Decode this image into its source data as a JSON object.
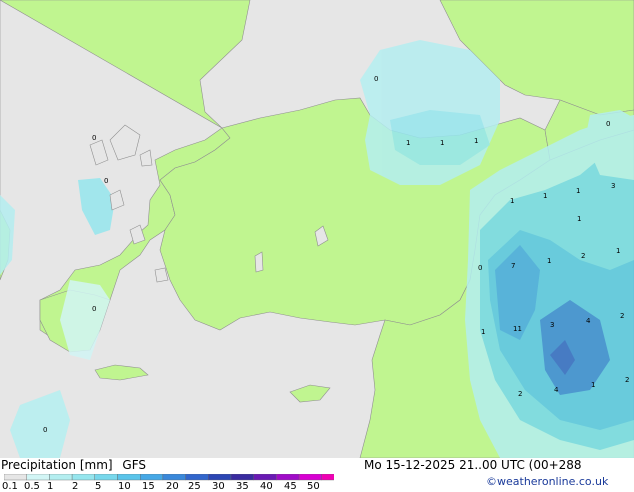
{
  "title": "Precipitation [mm]",
  "model": "GFS",
  "valid_time": "Mo 15-12-2025 21..00 UTC (00+288",
  "credit": "©weatheronline.co.uk",
  "colors": {
    "land": "#c0f590",
    "sea": "#e6e6e6",
    "border": "#909090"
  },
  "legend": {
    "labels": [
      "0.1",
      "0.5",
      "1",
      "2",
      "5",
      "10",
      "15",
      "20",
      "25",
      "30",
      "35",
      "40",
      "45",
      "50"
    ],
    "colors": [
      "#e6e6e6",
      "#d2f5f5",
      "#b4eef0",
      "#96e6ee",
      "#78d8ec",
      "#5ac4ea",
      "#46a8e6",
      "#3a88da",
      "#3266cc",
      "#2c46b4",
      "#3a2ca0",
      "#6a1ab4",
      "#a00cc8",
      "#d800d2",
      "#f000b4"
    ]
  },
  "map_labels": {
    "l0": "0",
    "l1": "0",
    "l2": "0",
    "l3": "0",
    "l4": "0",
    "l5": "0",
    "l6": "1",
    "l7": "1",
    "l8": "1",
    "l9": "1",
    "l10": "1",
    "l11": "1",
    "l12": "3",
    "l13": "1",
    "l14": "7",
    "l15": "1",
    "l16": "2",
    "l17": "1",
    "l18": "0",
    "l19": "1",
    "l20": "11",
    "l21": "3",
    "l22": "4",
    "l23": "2",
    "l24": "2",
    "l25": "4",
    "l26": "1",
    "l27": "2"
  }
}
